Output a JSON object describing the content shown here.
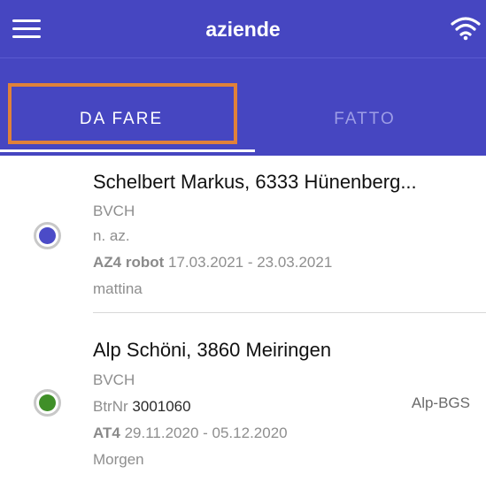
{
  "header": {
    "title": "aziende",
    "menu_icon": "hamburger-menu-icon",
    "status_icon": "wifi-icon"
  },
  "tabs": [
    {
      "label": "DA FARE",
      "active": true
    },
    {
      "label": "FATTO",
      "active": false
    }
  ],
  "items": [
    {
      "name": "Schelbert Markus, 6333 Hünenberg...",
      "org": "BVCH",
      "id_line": "n. az.",
      "task_code": "AZ4 robot",
      "date_range": "17.03.2021 - 23.03.2021",
      "slot": "mattina",
      "status_color": "#4b4bc7"
    },
    {
      "name": "Alp Schöni, 3860 Meiringen",
      "org": "BVCH",
      "id_label": "BtrNr",
      "id_value": "3001060",
      "tag": "Alp-BGS",
      "task_code": "AT4",
      "date_range": "29.11.2020 - 05.12.2020",
      "slot": "Morgen",
      "status_color": "#3f8f28"
    }
  ],
  "colors": {
    "primary": "#4646c1",
    "highlight": "#e0813a"
  }
}
